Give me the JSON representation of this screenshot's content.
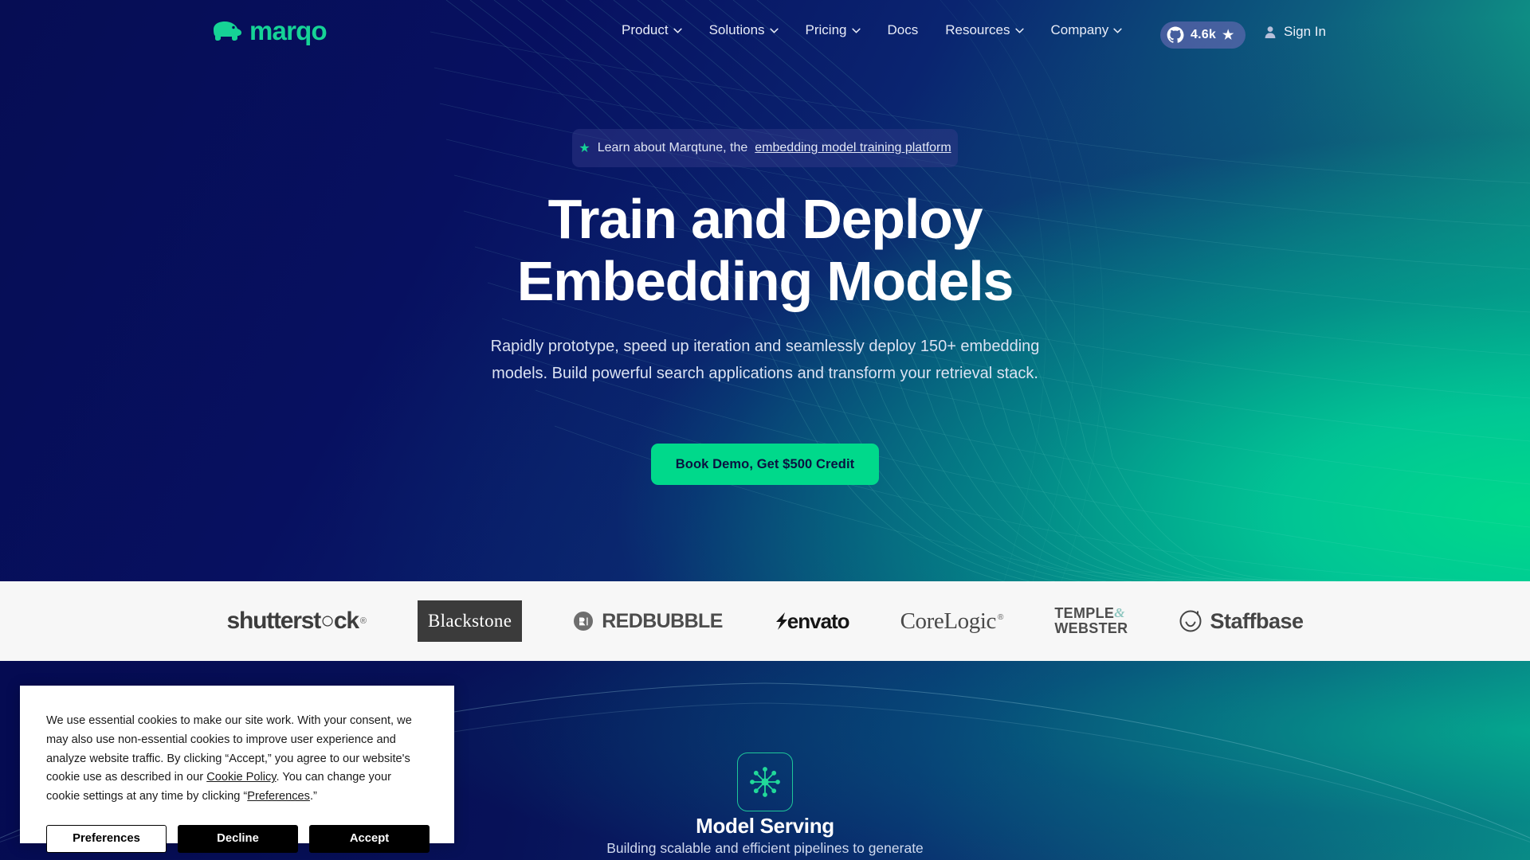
{
  "nav": {
    "logo_text": "marqo",
    "links": [
      {
        "label": "Product",
        "has_caret": true
      },
      {
        "label": "Solutions",
        "has_caret": true
      },
      {
        "label": "Pricing",
        "has_caret": true
      },
      {
        "label": "Docs",
        "has_caret": false
      },
      {
        "label": "Resources",
        "has_caret": true
      },
      {
        "label": "Company",
        "has_caret": true
      }
    ],
    "github_badge": {
      "count": "4.6k",
      "star": "★"
    },
    "sign_in": "Sign In"
  },
  "announcement": {
    "star": "★",
    "prefix": "Learn about Marqtune, the",
    "link": "embedding model training platform"
  },
  "hero": {
    "headline_line1": "Train and Deploy",
    "headline_line2": "Embedding Models",
    "subhead": "Rapidly prototype, speed up iteration and seamlessly deploy 150+ embedding models. Build powerful search applications and transform your retrieval stack.",
    "cta_label": "Book Demo, Get $500 Credit"
  },
  "logo_strip": {
    "brands": [
      {
        "name": "shutterstock",
        "label": "shutterst○ck",
        "mark": "®"
      },
      {
        "name": "blackstone",
        "label": "Blackstone"
      },
      {
        "name": "redbubble",
        "label": "REDBUBBLE"
      },
      {
        "name": "envato",
        "label": "envato"
      },
      {
        "name": "corelogic",
        "label": "CoreLogic",
        "mark": "®"
      },
      {
        "name": "temple-webster",
        "label_line1": "TEMPLE",
        "label_line2": "WEBSTER",
        "amp": "&"
      },
      {
        "name": "staffbase",
        "label": "Staffbase"
      }
    ]
  },
  "feature": {
    "icon_name": "model-serving-node-icon",
    "title": "Model Serving",
    "description": "Building scalable and efficient pipelines to generate"
  },
  "cookie_banner": {
    "body_part1": "We use essential cookies to make our site work. With your consent, we may also use non-essential cookies to improve user experience and analyze website traffic. By clicking “Accept,” you agree to our website's cookie use as described in our ",
    "link_cookie_policy": "Cookie Policy",
    "body_part2": ". You can change your cookie settings at any time by clicking “",
    "link_preferences": "Preferences",
    "body_part3": ".”",
    "buttons": {
      "preferences": "Preferences",
      "decline": "Decline",
      "accept": "Accept"
    }
  },
  "colors": {
    "brand_green": "#00d98b",
    "logo_green": "#16d396",
    "hero_navy": "#060d54",
    "hero_teal": "#0d5d7e",
    "cta_bg": "#00d98b",
    "cta_text": "#0a1240",
    "logo_strip_bg": "#f7f7f7",
    "cookie_bg": "#ffffff",
    "github_badge_bg": "rgba(118,112,190,0.55)"
  }
}
